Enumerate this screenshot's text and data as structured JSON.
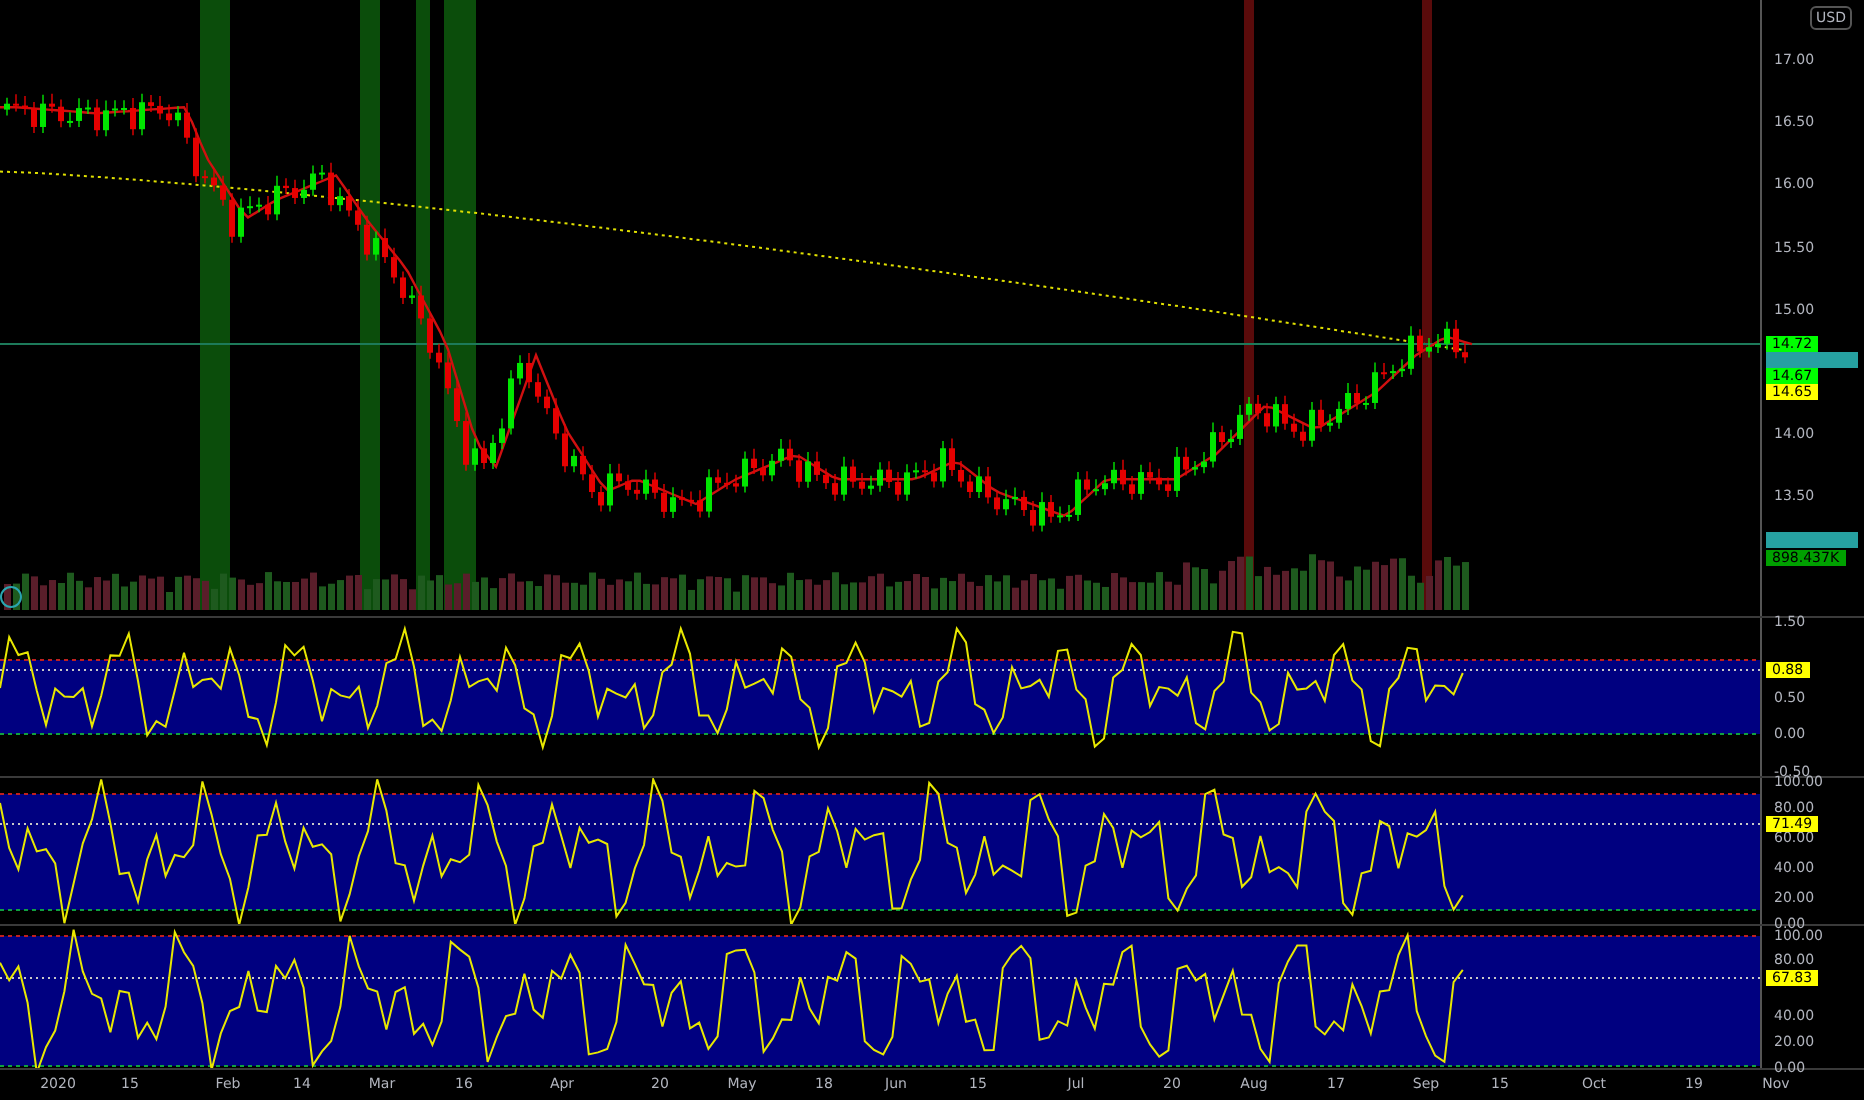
{
  "currency": "USD",
  "price_panel": {
    "ticks": [
      "17.00",
      "16.50",
      "16.00",
      "15.50",
      "15.00",
      "14.00",
      "13.50"
    ],
    "tags": [
      {
        "kind": "value",
        "text": "14.72",
        "color": "#00ff00"
      },
      {
        "kind": "marker",
        "color": "#26a0a0"
      },
      {
        "kind": "value",
        "text": "14.67",
        "color": "#00ff00"
      },
      {
        "kind": "value",
        "text": "14.65",
        "color": "#ffff00"
      }
    ],
    "volume_tags": [
      {
        "kind": "marker",
        "color": "#26a0a0"
      },
      {
        "kind": "value",
        "text": "898.437K",
        "color": "#00a000"
      }
    ]
  },
  "oscillators": [
    {
      "ticks": [
        "1.50",
        "0.50",
        "0.00",
        "-0.50"
      ],
      "tag": "0.88"
    },
    {
      "ticks": [
        "100.00",
        "80.00",
        "60.00",
        "40.00",
        "20.00",
        "0.00"
      ],
      "tag": "71.49"
    },
    {
      "ticks": [
        "100.00",
        "80.00",
        "40.00",
        "20.00",
        "0.00"
      ],
      "tag": "67.83"
    }
  ],
  "time_axis": [
    "2020",
    "15",
    "Feb",
    "14",
    "Mar",
    "16",
    "Apr",
    "20",
    "May",
    "18",
    "Jun",
    "15",
    "Jul",
    "20",
    "Aug",
    "17",
    "Sep",
    "15",
    "Oct",
    "19",
    "Nov"
  ]
}
